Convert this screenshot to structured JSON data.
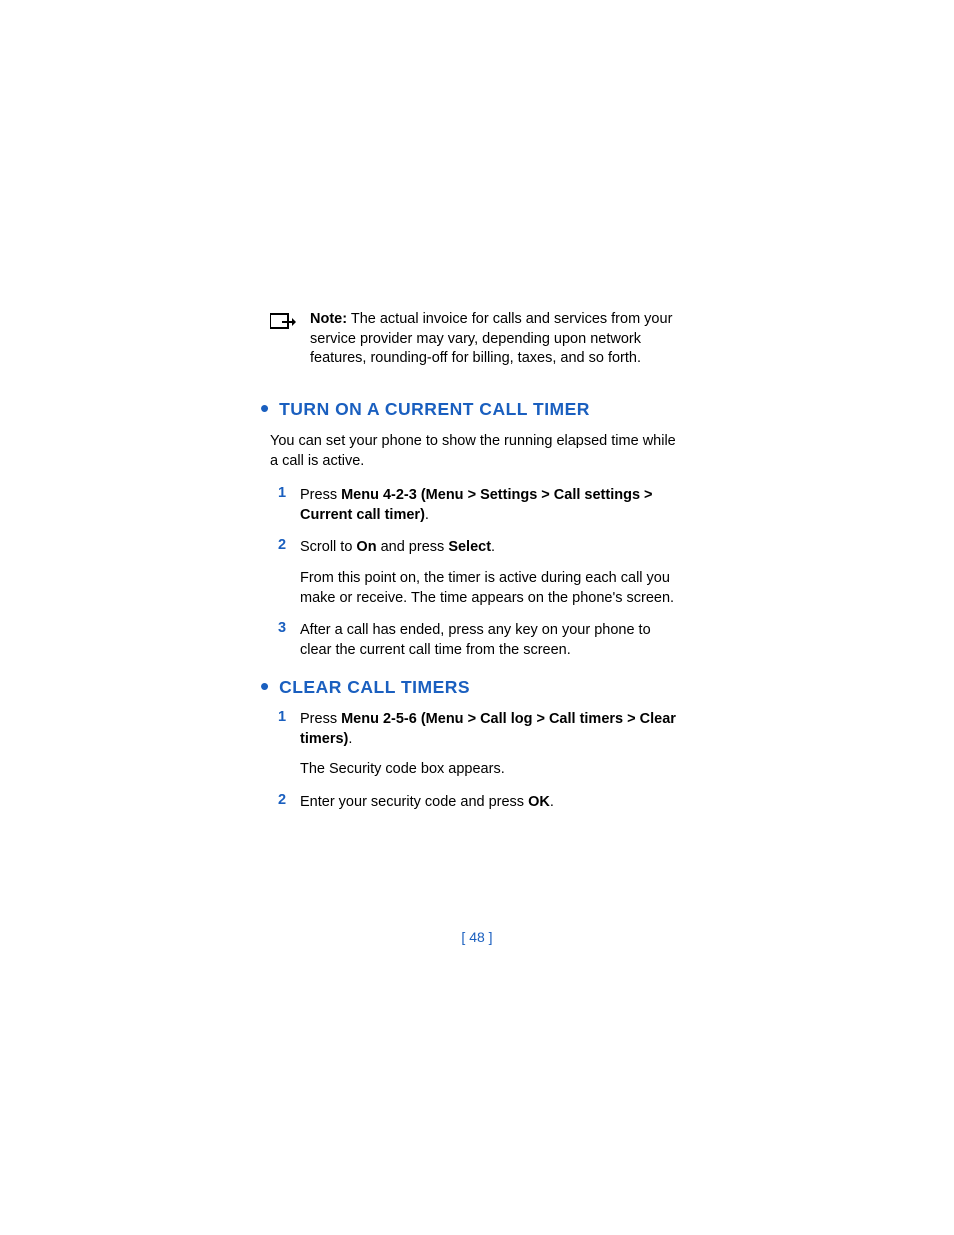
{
  "accent_color": "#1a5fbf",
  "note": {
    "label": "Note:",
    "text": "The actual invoice for calls and services from your service provider may vary, depending upon network features, rounding-off for billing, taxes, and so forth."
  },
  "sections": [
    {
      "title": "TURN ON A CURRENT CALL TIMER",
      "intro": "You can set your phone to show the running elapsed time while a call is active.",
      "steps": [
        {
          "num": "1",
          "lead": "Press ",
          "bold": "Menu 4-2-3 (Menu > Settings > Call settings > Current call timer)",
          "trail": "."
        },
        {
          "num": "2",
          "lead": "Scroll to ",
          "bold": "On",
          "mid": " and press ",
          "bold2": "Select",
          "trail": ".",
          "extra": "From this point on, the timer is active during each call you make or receive. The time appears on the phone's screen."
        },
        {
          "num": "3",
          "lead": "After a call has ended, press any key on your phone to clear the current call time from the screen."
        }
      ]
    },
    {
      "title": "CLEAR CALL TIMERS",
      "steps": [
        {
          "num": "1",
          "lead": "Press ",
          "bold": "Menu 2-5-6 (Menu > Call log > Call timers > Clear timers)",
          "trail": ".",
          "extra": "The Security code box appears."
        },
        {
          "num": "2",
          "lead": "Enter your security code and press ",
          "bold": "OK",
          "trail": "."
        }
      ]
    }
  ],
  "page_number": "[ 48 ]"
}
